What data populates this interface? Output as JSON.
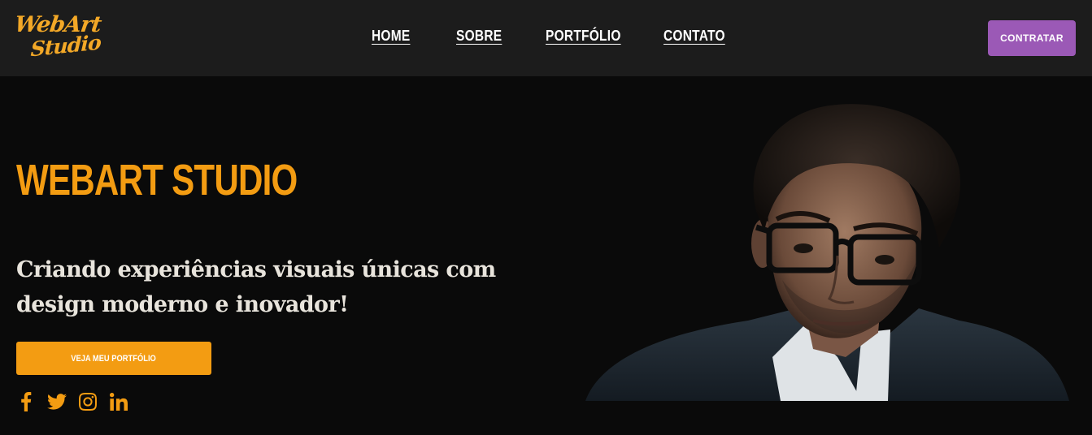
{
  "brand": {
    "logo_line1": "WebArt",
    "logo_line2": "Studio",
    "accent": "#f3a827"
  },
  "nav": {
    "items": [
      "HOME",
      "SOBRE",
      "PORTFÓLIO",
      "CONTATO"
    ]
  },
  "header": {
    "cta_label": "CONTRATAR",
    "cta_color": "#9b59b6"
  },
  "hero": {
    "title": "WEBART STUDIO",
    "subtitle": "Criando experiências visuais únicas com design moderno e inovador!",
    "button_label": "VEJA MEU PORTFÓLIO",
    "accent": "#f39c12"
  },
  "social": {
    "icons": [
      "facebook-icon",
      "twitter-icon",
      "instagram-icon",
      "linkedin-icon"
    ]
  },
  "colors": {
    "topbar": "#1c1c1c",
    "background": "#0a0a0a",
    "text_light": "#e8e4dc"
  }
}
